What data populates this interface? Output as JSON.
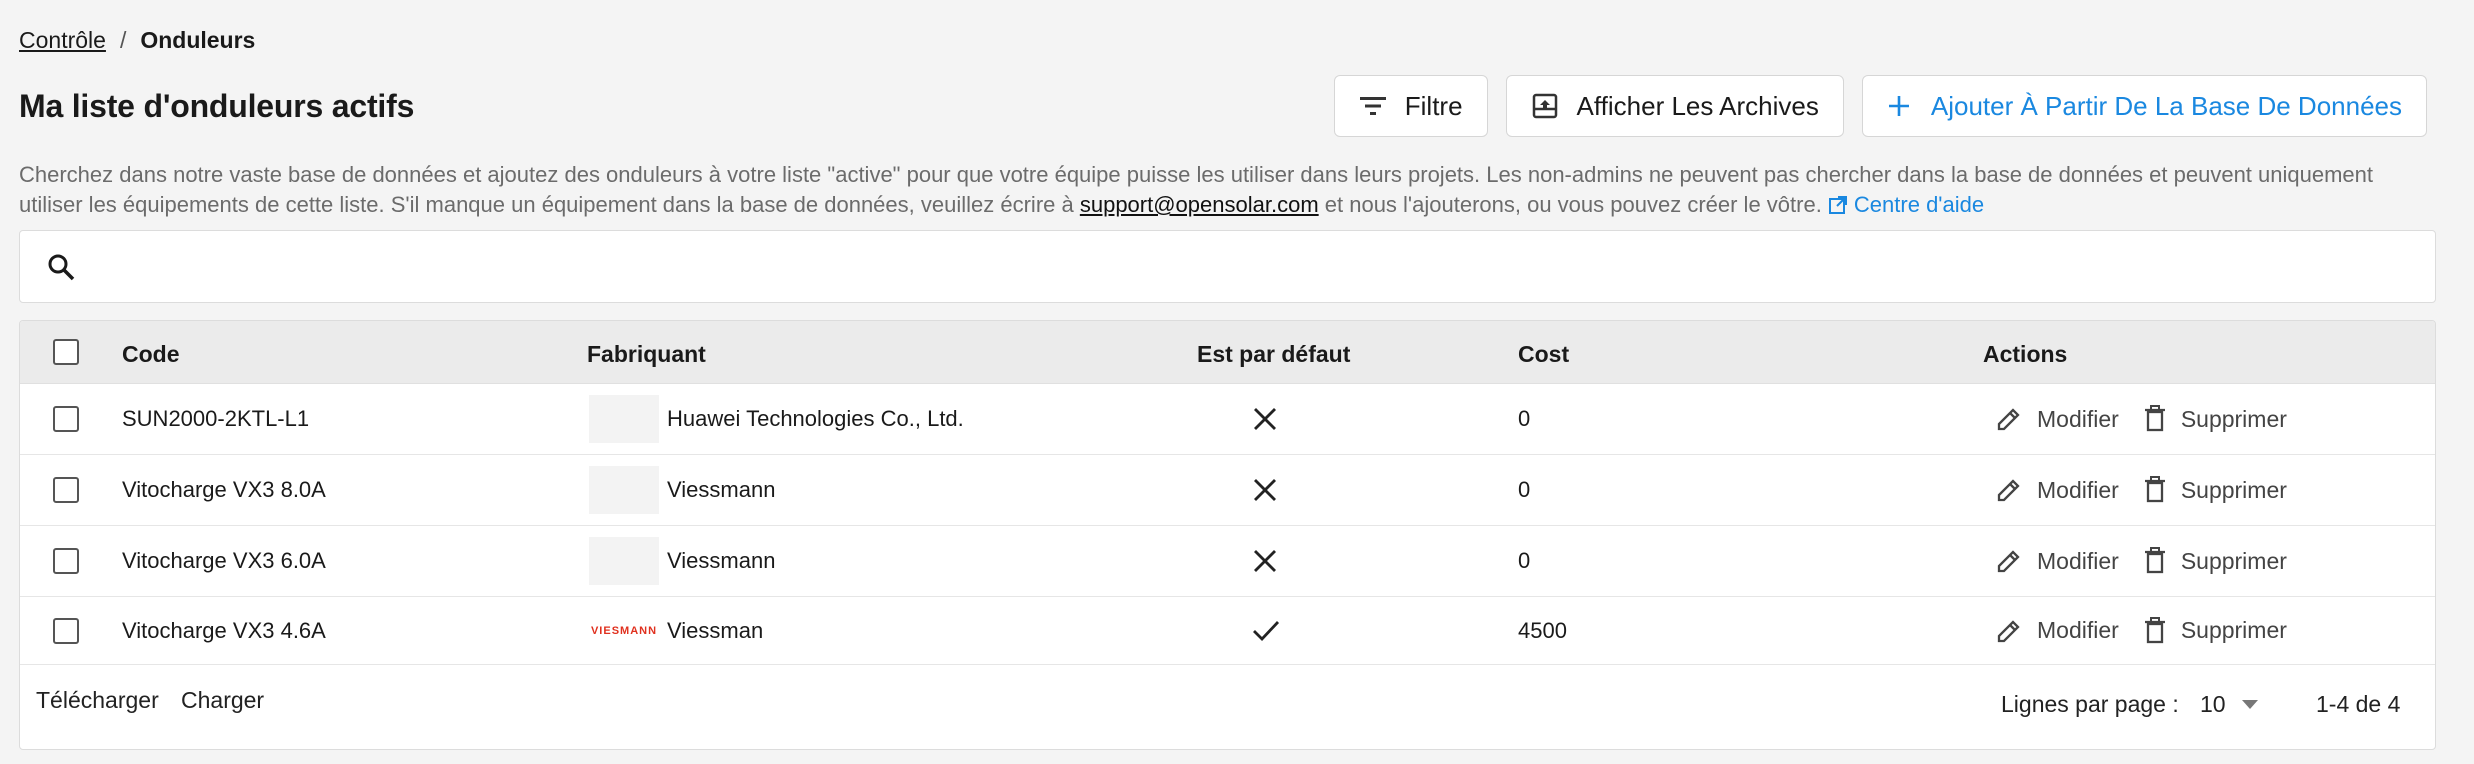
{
  "breadcrumb": {
    "parent": "Contrôle",
    "separator": "/",
    "current": "Onduleurs"
  },
  "page": {
    "title": "Ma liste d'onduleurs actifs"
  },
  "toolbar": {
    "filter_label": "Filtre",
    "archives_label": "Afficher Les Archives",
    "add_label": "Ajouter À Partir De La Base De Données"
  },
  "description": {
    "text_1": "Cherchez dans notre vaste base de données et ajoutez des onduleurs à votre liste \"active\" pour que votre équipe puisse les utiliser dans leurs projets. Les non-admins ne peuvent pas chercher dans la base de données et peuvent uniquement utiliser les équipements de cette liste. S'il manque un équipement dans la base de données, veuillez écrire à ",
    "email": "support@opensolar.com",
    "text_2": " et nous l'ajouterons, ou vous pouvez créer le vôtre. ",
    "help_link": "Centre d'aide"
  },
  "search": {
    "placeholder": "",
    "value": ""
  },
  "table": {
    "headers": {
      "code": "Code",
      "manufacturer": "Fabriquant",
      "default": "Est par défaut",
      "cost": "Cost",
      "actions": "Actions"
    },
    "rows": [
      {
        "code": "SUN2000-2KTL-L1",
        "manufacturer": "Huawei Technologies Co., Ltd.",
        "logo": "",
        "is_default": false,
        "cost": "0"
      },
      {
        "code": "Vitocharge VX3 8.0A",
        "manufacturer": "Viessmann",
        "logo": "",
        "is_default": false,
        "cost": "0"
      },
      {
        "code": "Vitocharge VX3 6.0A",
        "manufacturer": "Viessmann",
        "logo": "",
        "is_default": false,
        "cost": "0"
      },
      {
        "code": "Vitocharge VX3 4.6A",
        "manufacturer": "Viessman",
        "logo": "VIESMANN",
        "is_default": true,
        "cost": "4500"
      }
    ],
    "edit_label": "Modifier",
    "delete_label": "Supprimer"
  },
  "footer": {
    "download_label": "Télécharger",
    "upload_label": "Charger",
    "rows_per_page_label": "Lignes par page :",
    "rows_per_page_value": "10",
    "range": "1-4 de 4"
  },
  "colors": {
    "accent": "#1a88e0",
    "header_bg": "#ebebeb",
    "page_bg": "#f4f4f4",
    "logo_red": "#e0301e"
  }
}
